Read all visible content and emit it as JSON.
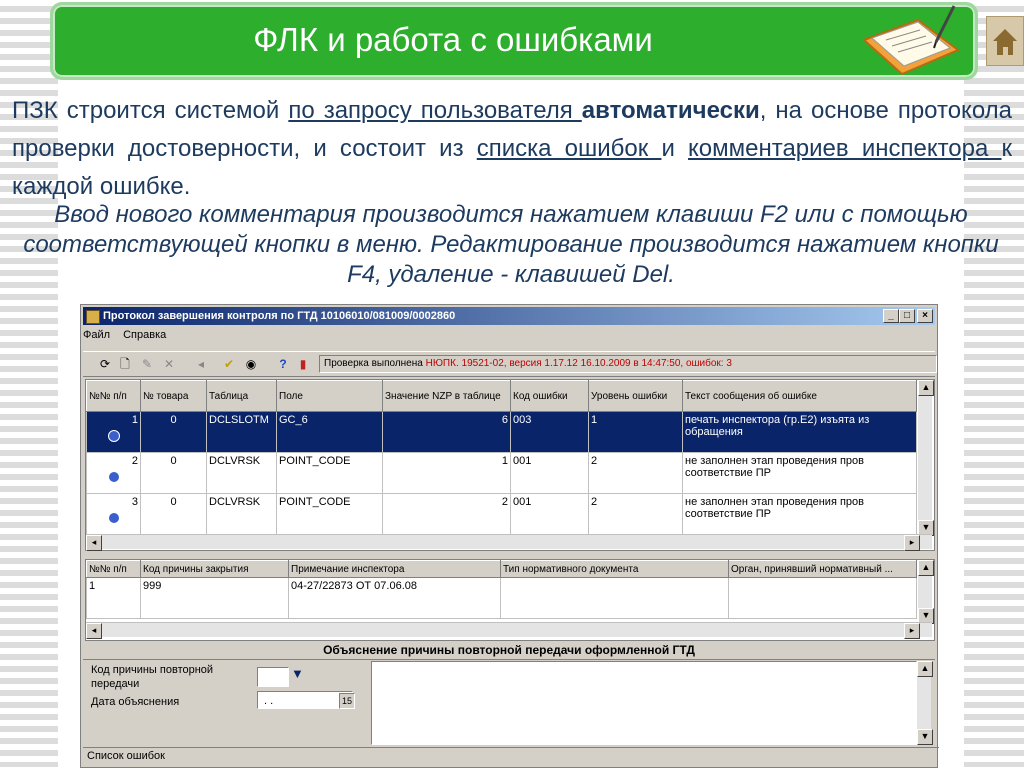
{
  "slide": {
    "title": "ФЛК и работа с ошибками",
    "para1_a": "ПЗК строится системой ",
    "para1_link1": "по запросу пользователя ",
    "para1_bold": "автоматически",
    "para1_b": ", на основе протокола проверки достоверности, и состоит из ",
    "para1_link2": "списка ошибок ",
    "para1_c": "и ",
    "para1_link3": "комментариев инспектора ",
    "para1_d": "к каждой ошибке.",
    "para2": "Ввод нового комментария производится нажатием клавиши F2 или с помощью соответствующей кнопки в меню. Редактирование производится нажатием кнопки F4, удаление - клавишей Del."
  },
  "window": {
    "title": "Протокол завершения контроля по ГТД 10106010/081009/0002860",
    "controls": [
      "_",
      "□",
      "×"
    ],
    "menu": [
      "Файл",
      "Справка"
    ],
    "status_prefix": "Проверка выполнена ",
    "status_value": "НЮПК. 19521-02, версия 1.17.12 16.10.2009 в 14:47:50, ошибок: 3",
    "errors_table": {
      "headers": [
        "№№ п/п",
        "№ товара",
        "Таблица",
        "Поле",
        "Значение NZP в таблице",
        "Код ошибки",
        "Уровень ошибки",
        "Текст сообщения об ошибке"
      ],
      "rows": [
        [
          "1",
          "0",
          "DCLSLOTM",
          "GC_6",
          "6",
          "003",
          "1",
          "печать инспектора (гр.Е2) изъята из обращения"
        ],
        [
          "2",
          "0",
          "DCLVRSK",
          "POINT_CODE",
          "1",
          "001",
          "2",
          "не заполнен этап проведения пров соответствие ПР"
        ],
        [
          "3",
          "0",
          "DCLVRSK",
          "POINT_CODE",
          "2",
          "001",
          "2",
          "не заполнен этап проведения пров соответствие ПР"
        ]
      ]
    },
    "comments_table": {
      "headers": [
        "№№ п/п",
        "Код причины закрытия",
        "Примечание инспектора",
        "Тип нормативного документа",
        "Орган, принявший нормативный ..."
      ],
      "rows": [
        [
          "1",
          "999",
          "04-27/22873 ОТ 07.06.08",
          "",
          ""
        ]
      ]
    },
    "explanation_header": "Объяснение причины повторной передачи оформленной ГТД",
    "reason_label": "Код причины повторной передачи",
    "date_label": "Дата объяснения",
    "date_value": ". .",
    "statusbar": "Список ошибок"
  },
  "colors": {
    "title_bg": "#2dae2d",
    "text": "#1d3a5f",
    "selection": "#0a246a",
    "window_bg": "#d4d0c8"
  }
}
